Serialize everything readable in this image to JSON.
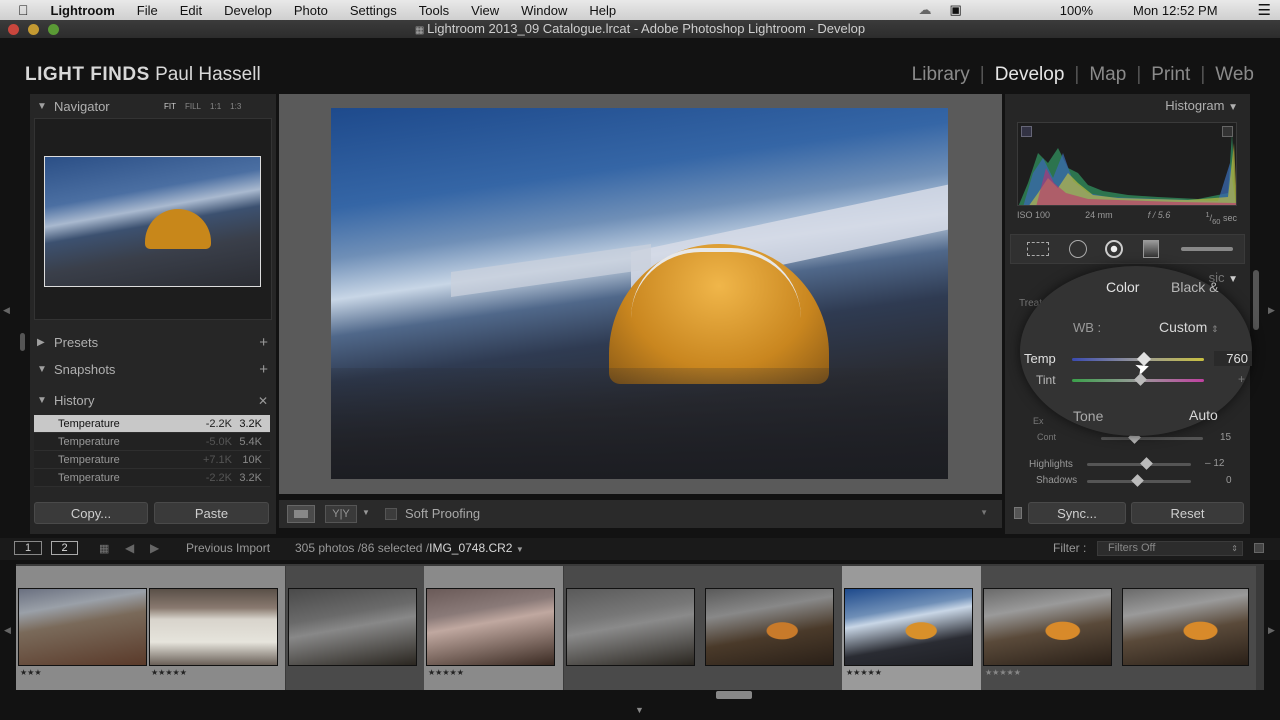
{
  "menubar": {
    "app": "Lightroom",
    "items": [
      "File",
      "Edit",
      "Develop",
      "Photo",
      "Settings",
      "Tools",
      "View",
      "Window",
      "Help"
    ],
    "battery": "100%",
    "clock": "Mon 12:52 PM"
  },
  "window": {
    "title": "Lightroom 2013_09 Catalogue.lrcat - Adobe Photoshop Lightroom - Develop"
  },
  "identity": {
    "brand": "LIGHT FINDS",
    "owner": "Paul Hassell"
  },
  "modules": [
    "Library",
    "Develop",
    "Map",
    "Print",
    "Web"
  ],
  "active_module": "Develop",
  "left": {
    "navigator": {
      "title": "Navigator",
      "zoom_options": [
        "FIT",
        "FILL",
        "1:1",
        "1:3"
      ]
    },
    "presets": "Presets",
    "snapshots": "Snapshots",
    "history": {
      "title": "History",
      "rows": [
        {
          "label": "Temperature",
          "v1": "-2.2K",
          "v2": "3.2K"
        },
        {
          "label": "Temperature",
          "v1": "-5.0K",
          "v2": "5.4K"
        },
        {
          "label": "Temperature",
          "v1": "+7.1K",
          "v2": "10K"
        },
        {
          "label": "Temperature",
          "v1": "-2.2K",
          "v2": "3.2K"
        }
      ]
    },
    "copy": "Copy...",
    "paste": "Paste"
  },
  "toolbar": {
    "soft_proofing": "Soft Proofing"
  },
  "right": {
    "histogram": {
      "title": "Histogram",
      "iso": "ISO 100",
      "focal": "24 mm",
      "aperture": "f / 5.6",
      "shutter_num": "1",
      "shutter_den": "60",
      "shutter_unit": "sec"
    },
    "basic": {
      "tab_color": "Color",
      "tab_bw": "Black &",
      "treatment": "Treat",
      "wb_label": "WB :",
      "wb_value": "Custom",
      "temp_label": "Temp",
      "temp_value": "760",
      "tint_label": "Tint",
      "tone_label": "Tone",
      "auto": "Auto",
      "exposure_label": "Ex",
      "contrast_label": "Cont",
      "contrast_value": "15",
      "highlights_label": "Highlights",
      "highlights_value": "– 12",
      "shadows_label": "Shadows",
      "shadows_value": "0",
      "header_partial": "sic"
    },
    "sync": "Sync...",
    "reset": "Reset"
  },
  "filmstrip": {
    "page1": "1",
    "page2": "2",
    "source": "Previous Import",
    "count": "305 photos /86 selected /",
    "filename": "IMG_0748.CR2",
    "filter_label": "Filter :",
    "filter_value": "Filters Off",
    "stars": "★★★★★",
    "stars_short": "★★★"
  },
  "colors": {
    "accent_panel": "#2a2a2a",
    "background": "#121212",
    "highlight": "#cfcfcf"
  }
}
